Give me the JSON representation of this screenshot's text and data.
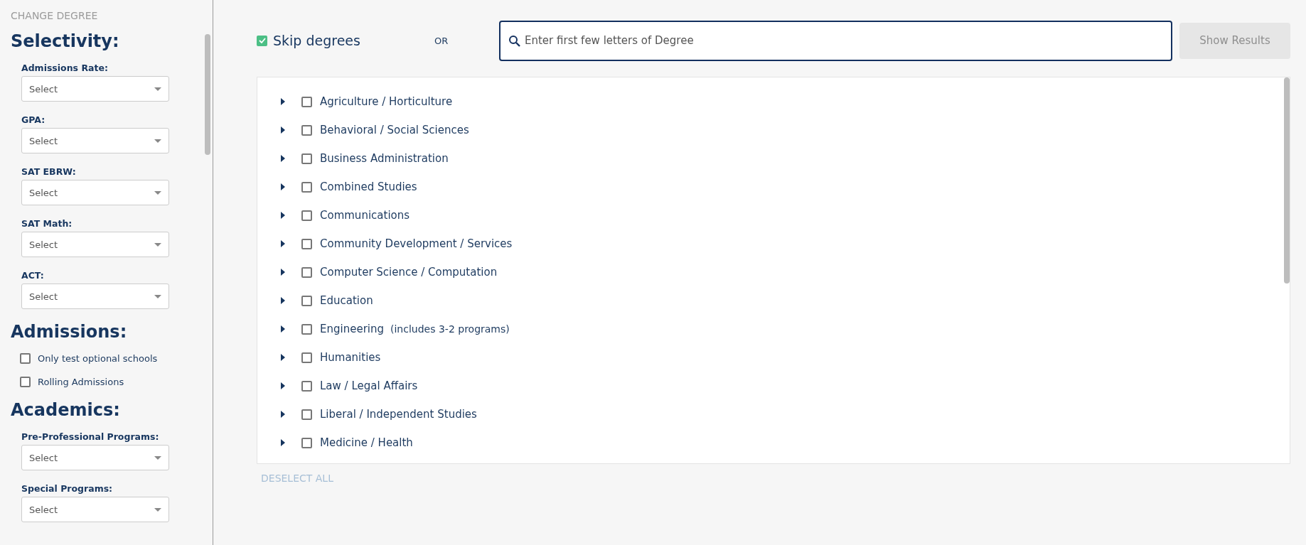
{
  "sidebar": {
    "back_link": "CHANGE DEGREE",
    "sections": [
      {
        "title": "Selectivity:",
        "items": [
          {
            "kind": "select",
            "label": "Admissions Rate:",
            "placeholder": "Select"
          },
          {
            "kind": "select",
            "label": "GPA:",
            "placeholder": "Select"
          },
          {
            "kind": "select",
            "label": "SAT EBRW:",
            "placeholder": "Select"
          },
          {
            "kind": "select",
            "label": "SAT Math:",
            "placeholder": "Select"
          },
          {
            "kind": "select",
            "label": "ACT:",
            "placeholder": "Select"
          }
        ]
      },
      {
        "title": "Admissions:",
        "items": [
          {
            "kind": "checkbox",
            "label": "Only test optional schools",
            "checked": false
          },
          {
            "kind": "checkbox",
            "label": "Rolling Admissions",
            "checked": false
          }
        ]
      },
      {
        "title": "Academics:",
        "items": [
          {
            "kind": "select",
            "label": "Pre-Professional Programs:",
            "placeholder": "Select"
          },
          {
            "kind": "select",
            "label": "Special Programs:",
            "placeholder": "Select"
          }
        ]
      }
    ]
  },
  "toolbar": {
    "skip": {
      "label": "Skip degrees",
      "checked": true
    },
    "or_label": "OR",
    "search": {
      "placeholder": "Enter first few letters of Degree"
    },
    "show_results": {
      "label": "Show Results",
      "disabled": true
    }
  },
  "degrees": [
    {
      "label": "Agriculture / Horticulture",
      "checked": false,
      "expanded": false
    },
    {
      "label": "Behavioral / Social Sciences",
      "checked": false,
      "expanded": false
    },
    {
      "label": "Business Administration",
      "checked": false,
      "expanded": false
    },
    {
      "label": "Combined Studies",
      "checked": false,
      "expanded": false
    },
    {
      "label": "Communications",
      "checked": false,
      "expanded": false
    },
    {
      "label": "Community Development / Services",
      "checked": false,
      "expanded": false
    },
    {
      "label": "Computer Science / Computation",
      "checked": false,
      "expanded": false
    },
    {
      "label": "Education",
      "checked": false,
      "expanded": false
    },
    {
      "label": "Engineering",
      "note": "(includes 3-2 programs)",
      "checked": false,
      "expanded": false
    },
    {
      "label": "Humanities",
      "checked": false,
      "expanded": false
    },
    {
      "label": "Law / Legal Affairs",
      "checked": false,
      "expanded": false
    },
    {
      "label": "Liberal / Independent Studies",
      "checked": false,
      "expanded": false
    },
    {
      "label": "Medicine / Health",
      "checked": false,
      "expanded": false
    }
  ],
  "deselect_all": "DESELECT ALL"
}
